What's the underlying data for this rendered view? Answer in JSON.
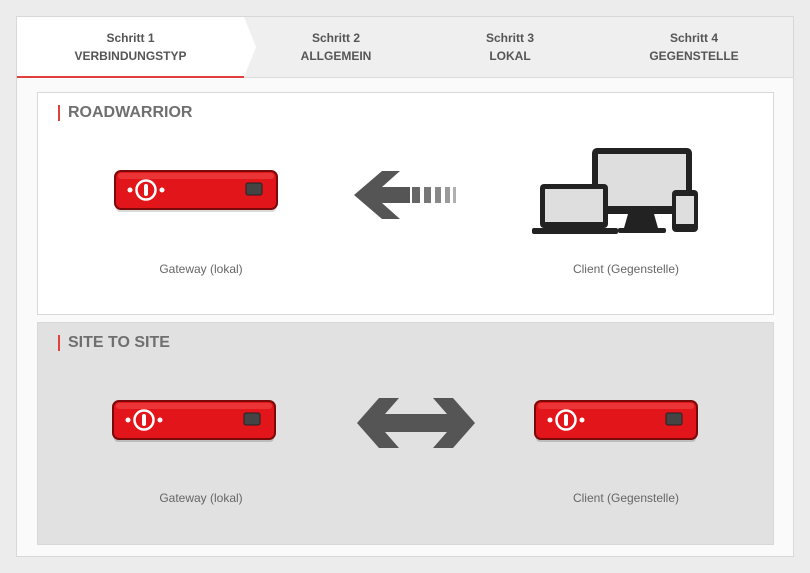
{
  "wizard": {
    "steps": [
      {
        "number": "Schritt 1",
        "label": "VERBINDUNGSTYP",
        "active": true
      },
      {
        "number": "Schritt 2",
        "label": "ALLGEMEIN",
        "active": false
      },
      {
        "number": "Schritt 3",
        "label": "LOKAL",
        "active": false
      },
      {
        "number": "Schritt 4",
        "label": "GEGENSTELLE",
        "active": false
      }
    ],
    "accent_color": "#e2413b"
  },
  "options": {
    "roadwarrior": {
      "title": "ROADWARRIOR",
      "left_caption": "Gateway (lokal)",
      "right_caption": "Client (Gegenstelle)",
      "left_icon": "gateway-device-icon",
      "middle_icon": "arrow-left-icon",
      "right_icon": "client-devices-icon"
    },
    "site_to_site": {
      "title": "SITE TO SITE",
      "left_caption": "Gateway (lokal)",
      "right_caption": "Client (Gegenstelle)",
      "left_icon": "gateway-device-icon",
      "middle_icon": "bidirectional-arrow-icon",
      "right_icon": "gateway-device-icon"
    }
  },
  "colors": {
    "device_red": "#e2151b",
    "arrow_gray": "#555555"
  }
}
